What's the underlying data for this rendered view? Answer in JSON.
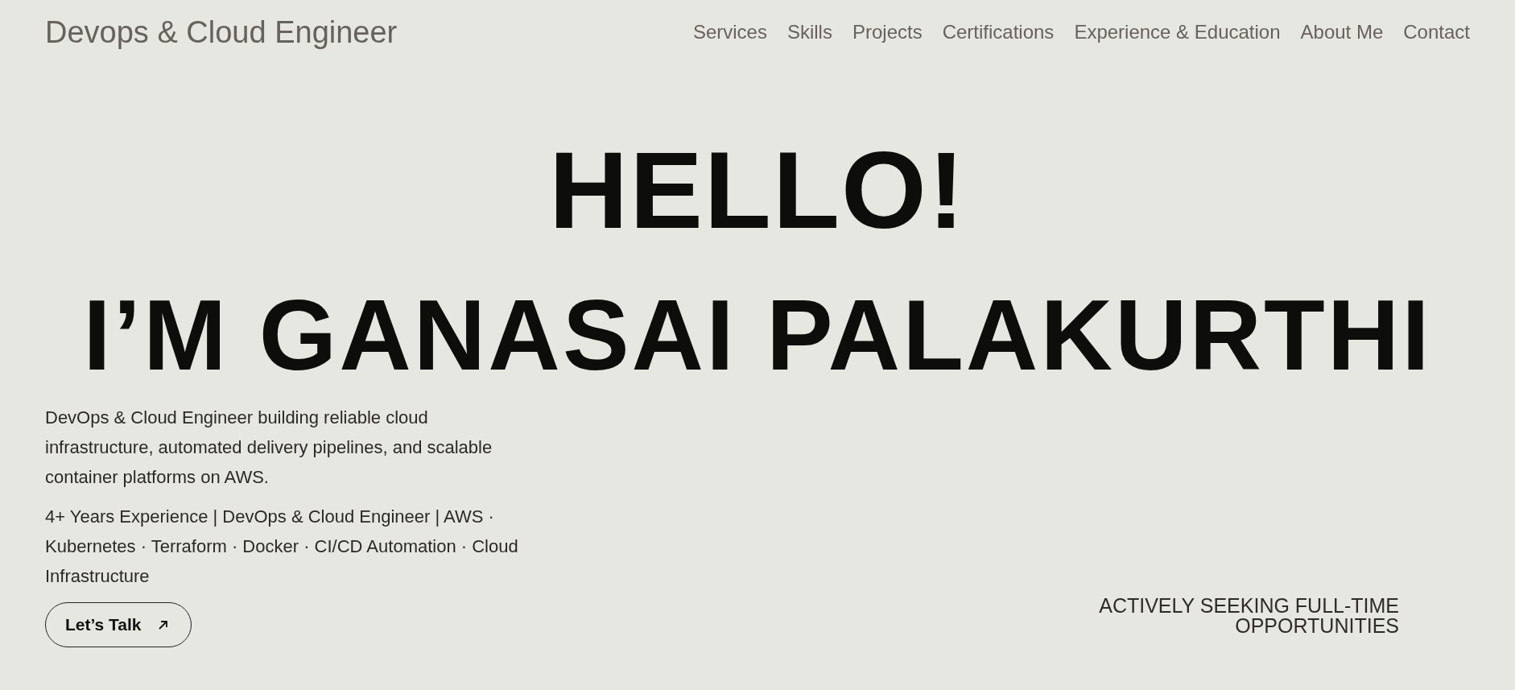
{
  "header": {
    "brand": "Devops & Cloud Engineer",
    "nav": [
      {
        "label": "Services"
      },
      {
        "label": "Skills"
      },
      {
        "label": "Projects"
      },
      {
        "label": "Certifications"
      },
      {
        "label": "Experience & Education"
      },
      {
        "label": "About Me"
      },
      {
        "label": "Contact"
      }
    ]
  },
  "hero": {
    "greeting": "HELLO!",
    "name": "I’M GANASAI PALAKURTHI",
    "intro": "DevOps & Cloud Engineer building reliable cloud infrastructure, automated delivery pipelines, and scalable container platforms on AWS.",
    "summary": "4+ Years Experience | DevOps & Cloud Engineer | AWS · Kubernetes · Terraform · Docker · CI/CD Automation · Cloud Infrastructure",
    "cta": "Let’s Talk",
    "status": [
      "ACTIVELY SEEKING FULL-TIME",
      "OPPORTUNITIES"
    ]
  }
}
